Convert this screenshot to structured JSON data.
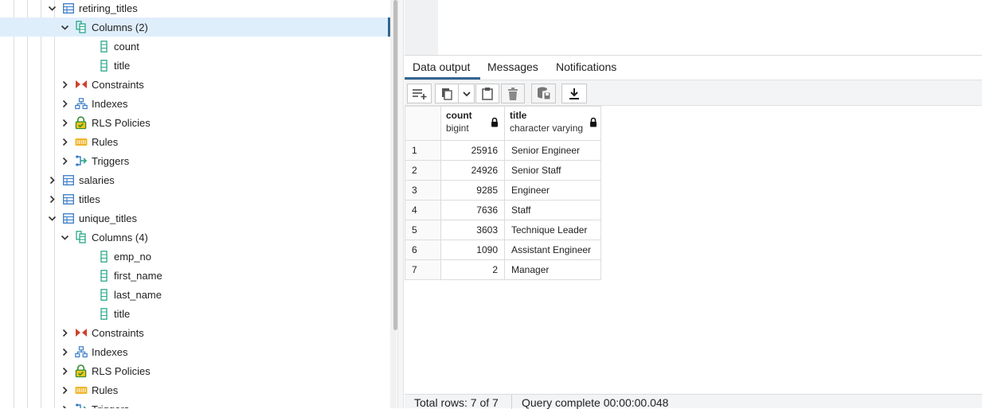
{
  "tree": {
    "items": [
      {
        "label": "retiring_titles",
        "indent": 1,
        "chevron": "down",
        "icon": "table-icon"
      },
      {
        "label": "Columns (2)",
        "indent": 2,
        "chevron": "down",
        "icon": "columns-icon",
        "selected": true
      },
      {
        "label": "count",
        "indent": 3,
        "chevron": "none",
        "icon": "column-icon"
      },
      {
        "label": "title",
        "indent": 3,
        "chevron": "none",
        "icon": "column-icon"
      },
      {
        "label": "Constraints",
        "indent": 2,
        "chevron": "right",
        "icon": "constraints-icon"
      },
      {
        "label": "Indexes",
        "indent": 2,
        "chevron": "right",
        "icon": "indexes-icon"
      },
      {
        "label": "RLS Policies",
        "indent": 2,
        "chevron": "right",
        "icon": "rls-icon"
      },
      {
        "label": "Rules",
        "indent": 2,
        "chevron": "right",
        "icon": "rules-icon"
      },
      {
        "label": "Triggers",
        "indent": 2,
        "chevron": "right",
        "icon": "triggers-icon"
      },
      {
        "label": "salaries",
        "indent": 1,
        "chevron": "right",
        "icon": "table-icon"
      },
      {
        "label": "titles",
        "indent": 1,
        "chevron": "right",
        "icon": "table-icon"
      },
      {
        "label": "unique_titles",
        "indent": 1,
        "chevron": "down",
        "icon": "table-icon"
      },
      {
        "label": "Columns (4)",
        "indent": 2,
        "chevron": "down",
        "icon": "columns-icon"
      },
      {
        "label": "emp_no",
        "indent": 3,
        "chevron": "none",
        "icon": "column-icon"
      },
      {
        "label": "first_name",
        "indent": 3,
        "chevron": "none",
        "icon": "column-icon"
      },
      {
        "label": "last_name",
        "indent": 3,
        "chevron": "none",
        "icon": "column-icon"
      },
      {
        "label": "title",
        "indent": 3,
        "chevron": "none",
        "icon": "column-icon"
      },
      {
        "label": "Constraints",
        "indent": 2,
        "chevron": "right",
        "icon": "constraints-icon"
      },
      {
        "label": "Indexes",
        "indent": 2,
        "chevron": "right",
        "icon": "indexes-icon"
      },
      {
        "label": "RLS Policies",
        "indent": 2,
        "chevron": "right",
        "icon": "rls-icon"
      },
      {
        "label": "Rules",
        "indent": 2,
        "chevron": "right",
        "icon": "rules-icon"
      },
      {
        "label": "Triggers",
        "indent": 2,
        "chevron": "right",
        "icon": "triggers-icon"
      }
    ]
  },
  "tabs": [
    "Data output",
    "Messages",
    "Notifications"
  ],
  "toolbar": {
    "buttons": [
      "add-row-icon",
      "copy-icon",
      "chevron-down-icon",
      "paste-icon",
      "delete-icon",
      "save-data-icon",
      "download-icon"
    ]
  },
  "grid": {
    "columns": [
      {
        "name": "count",
        "type": "bigint"
      },
      {
        "name": "title",
        "type": "character varying"
      }
    ],
    "rows": [
      {
        "n": "1",
        "count": "25916",
        "title": "Senior Engineer"
      },
      {
        "n": "2",
        "count": "24926",
        "title": "Senior Staff"
      },
      {
        "n": "3",
        "count": "9285",
        "title": "Engineer"
      },
      {
        "n": "4",
        "count": "7636",
        "title": "Staff"
      },
      {
        "n": "5",
        "count": "3603",
        "title": "Technique Leader"
      },
      {
        "n": "6",
        "count": "1090",
        "title": "Assistant Engineer"
      },
      {
        "n": "7",
        "count": "2",
        "title": "Manager"
      }
    ]
  },
  "status": {
    "rows": "Total rows: 7 of 7",
    "query": "Query complete 00:00:00.048"
  },
  "colors": {
    "accent": "#326690",
    "selected_bg": "#dfeefb",
    "icon_green": "#2aa889",
    "icon_red": "#d0422b",
    "icon_blue": "#3a7cc6",
    "icon_yellow": "#f0b429"
  }
}
